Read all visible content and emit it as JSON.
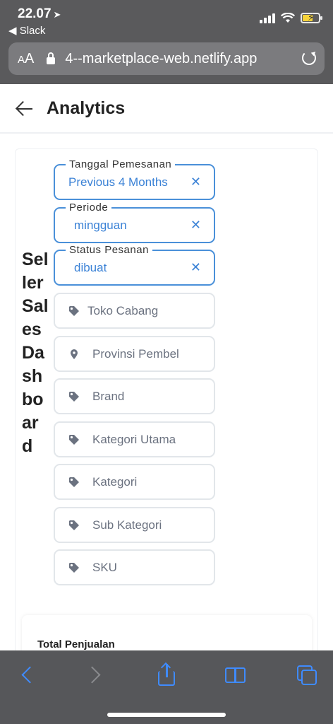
{
  "status": {
    "time": "22.07",
    "back_app": "◀ Slack"
  },
  "browser": {
    "aa": "AA",
    "url": "4--marketplace-web.netlify.app"
  },
  "header": {
    "title": "Analytics"
  },
  "dashboard": {
    "title": "Seller Sales Dashboard"
  },
  "active_filters": [
    {
      "label": "Tanggal Pemesanan",
      "value": "Previous 4 Months"
    },
    {
      "label": "Periode",
      "value": "mingguan"
    },
    {
      "label": "Status Pesanan",
      "value": "dibuat"
    }
  ],
  "filters": [
    {
      "label": "Toko Cabang",
      "icon": "tag-icon"
    },
    {
      "label": "Provinsi Pembel",
      "icon": "map-pin-icon"
    },
    {
      "label": "Brand",
      "icon": "tag-icon"
    },
    {
      "label": "Kategori Utama",
      "icon": "tag-icon"
    },
    {
      "label": "Kategori",
      "icon": "tag-icon"
    },
    {
      "label": "Sub Kategori",
      "icon": "tag-icon"
    },
    {
      "label": "SKU",
      "icon": "tag-icon"
    }
  ],
  "clear_symbol": "✕",
  "summary": {
    "total_label": "Total Penjualan"
  },
  "colors": {
    "accent": "#3b82d6",
    "chrome": "#5a5a5c",
    "ios_blue": "#3f8bff"
  }
}
